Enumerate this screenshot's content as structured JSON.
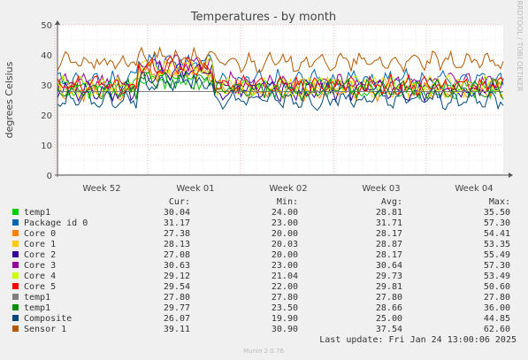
{
  "chart_data": {
    "type": "line",
    "title": "Temperatures - by month",
    "ylabel": "degrees Celsius",
    "xlabel": "",
    "ylim": [
      0,
      50
    ],
    "yticks": [
      0,
      10,
      20,
      30,
      40,
      50
    ],
    "x_labels": [
      "Week 52",
      "Week 01",
      "Week 02",
      "Week 03",
      "Week 04"
    ],
    "grid": true,
    "watermark": "RRDTOOL / TOBI OETIKER",
    "footer": "Munin 2.0.76",
    "last_update": "Last update: Fri Jan 24 13:00:06 2025",
    "legend_headers": {
      "cur": "Cur:",
      "min": "Min:",
      "avg": "Avg:",
      "max": "Max:"
    },
    "series": [
      {
        "name": "temp1",
        "color": "#00cc00",
        "cur": "30.04",
        "min": "24.00",
        "avg": "28.81",
        "max": "35.50"
      },
      {
        "name": "Package id 0",
        "color": "#0066b3",
        "cur": "31.17",
        "min": "23.00",
        "avg": "31.71",
        "max": "57.30"
      },
      {
        "name": "Core 0",
        "color": "#ff8000",
        "cur": "27.38",
        "min": "20.00",
        "avg": "28.17",
        "max": "54.41"
      },
      {
        "name": "Core 1",
        "color": "#ffcc00",
        "cur": "28.13",
        "min": "20.03",
        "avg": "28.87",
        "max": "53.35"
      },
      {
        "name": "Core 2",
        "color": "#330099",
        "cur": "27.08",
        "min": "20.00",
        "avg": "28.17",
        "max": "55.49"
      },
      {
        "name": "Core 3",
        "color": "#990099",
        "cur": "30.63",
        "min": "23.00",
        "avg": "30.64",
        "max": "57.30"
      },
      {
        "name": "Core 4",
        "color": "#ccff00",
        "cur": "29.12",
        "min": "21.04",
        "avg": "29.73",
        "max": "53.49"
      },
      {
        "name": "Core 5",
        "color": "#ff0000",
        "cur": "29.54",
        "min": "22.00",
        "avg": "29.81",
        "max": "50.60"
      },
      {
        "name": "temp1",
        "color": "#808080",
        "cur": "27.80",
        "min": "27.80",
        "avg": "27.80",
        "max": "27.80"
      },
      {
        "name": "temp1",
        "color": "#008f00",
        "cur": "29.77",
        "min": "23.50",
        "avg": "28.66",
        "max": "36.00"
      },
      {
        "name": "Composite",
        "color": "#00487d",
        "cur": "26.07",
        "min": "19.90",
        "avg": "25.00",
        "max": "44.85"
      },
      {
        "name": "Sensor 1",
        "color": "#b35a00",
        "cur": "39.11",
        "min": "30.90",
        "avg": "37.54",
        "max": "62.60"
      }
    ]
  }
}
